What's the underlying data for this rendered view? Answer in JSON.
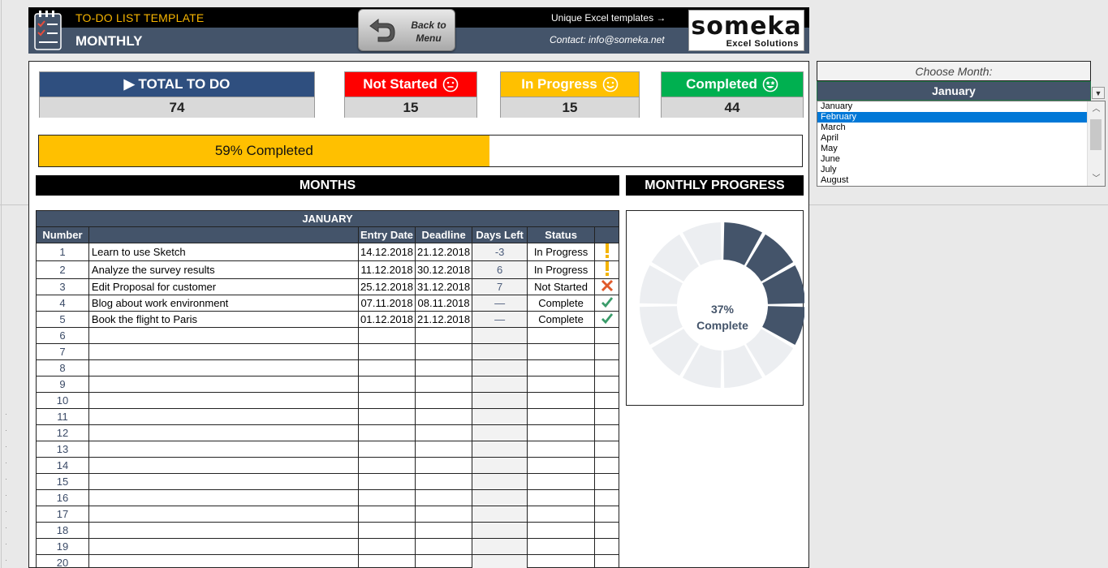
{
  "header": {
    "template_title": "TO-DO LIST TEMPLATE",
    "subtitle": "MONTHLY",
    "back_button": "Back to Menu",
    "unique_text": "Unique Excel templates →",
    "contact": "Contact: info@someka.net",
    "brand_name": "someka",
    "brand_sub": "Excel Solutions"
  },
  "summary": {
    "total_label": "▶ TOTAL TO DO",
    "total_value": "74",
    "not_started_label": "Not Started",
    "not_started_value": "15",
    "in_progress_label": "In Progress",
    "in_progress_value": "15",
    "completed_label": "Completed",
    "completed_value": "44",
    "colors": {
      "total": "#1f4e79",
      "not_started": "#ff0000",
      "in_progress": "#ffc000",
      "completed": "#00b050"
    }
  },
  "progress": {
    "text": "59% Completed",
    "fraction": 0.59
  },
  "bands": {
    "months": "MONTHS",
    "monthly_progress": "MONTHLY PROGRESS"
  },
  "table": {
    "month": "JANUARY",
    "headers": [
      "Number",
      "",
      "Entry Date",
      "Deadline",
      "Days Left",
      "Status",
      ""
    ],
    "rows": [
      {
        "num": "1",
        "task": "Learn to use Sketch",
        "entry": "14.12.2018",
        "deadline": "21.12.2018",
        "days": "-3",
        "status": "In Progress",
        "icon": "exclamation-icon"
      },
      {
        "num": "2",
        "task": "Analyze the survey results",
        "entry": "11.12.2018",
        "deadline": "30.12.2018",
        "days": "6",
        "status": "In Progress",
        "icon": "exclamation-icon"
      },
      {
        "num": "3",
        "task": "Edit Proposal for customer",
        "entry": "25.12.2018",
        "deadline": "31.12.2018",
        "days": "7",
        "status": "Not Started",
        "icon": "cross-icon"
      },
      {
        "num": "4",
        "task": "Blog about work environment",
        "entry": "07.11.2018",
        "deadline": "08.11.2018",
        "days": "—",
        "status": "Complete",
        "icon": "check-icon"
      },
      {
        "num": "5",
        "task": "Book the flight to Paris",
        "entry": "01.12.2018",
        "deadline": "21.12.2018",
        "days": "—",
        "status": "Complete",
        "icon": "check-icon"
      },
      {
        "num": "6"
      },
      {
        "num": "7"
      },
      {
        "num": "8"
      },
      {
        "num": "9"
      },
      {
        "num": "10"
      },
      {
        "num": "11"
      },
      {
        "num": "12"
      },
      {
        "num": "13"
      },
      {
        "num": "14"
      },
      {
        "num": "15"
      },
      {
        "num": "16"
      },
      {
        "num": "17"
      },
      {
        "num": "18"
      },
      {
        "num": "19"
      },
      {
        "num": "20"
      }
    ]
  },
  "donut": {
    "percent_text": "37%",
    "label": "Complete",
    "segments_total": 12,
    "segments_filled": 4,
    "fill_color": "#44546a",
    "empty_color": "#eceef1"
  },
  "month_picker": {
    "label": "Choose Month:",
    "selected": "January",
    "options": [
      "January",
      "February",
      "March",
      "April",
      "May",
      "June",
      "July",
      "August"
    ],
    "highlighted": "February"
  }
}
